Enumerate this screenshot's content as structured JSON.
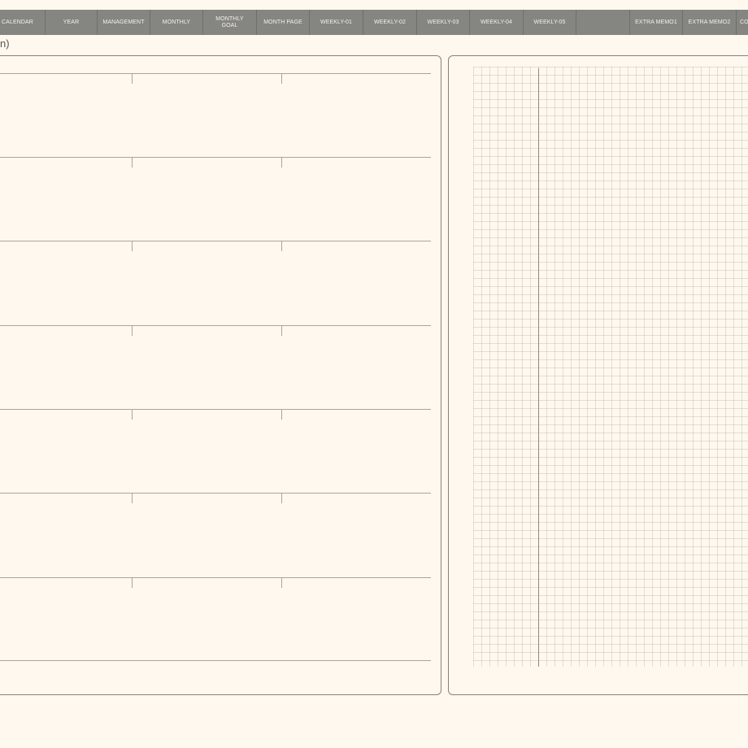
{
  "tabs": [
    {
      "name": "tab-calendar",
      "label": "CALENDAR"
    },
    {
      "name": "tab-year",
      "label": "YEAR"
    },
    {
      "name": "tab-management",
      "label": "MANAGEMENT"
    },
    {
      "name": "tab-monthly",
      "label": "MONTHLY"
    },
    {
      "name": "tab-monthly-goal",
      "label": "MONTHLY\nGOAL"
    },
    {
      "name": "tab-month-page",
      "label": "MONTH PAGE"
    },
    {
      "name": "tab-weekly-01",
      "label": "WEEKLY-01"
    },
    {
      "name": "tab-weekly-02",
      "label": "WEEKLY-02"
    },
    {
      "name": "tab-weekly-03",
      "label": "WEEKLY-03"
    },
    {
      "name": "tab-weekly-04",
      "label": "WEEKLY-04"
    },
    {
      "name": "tab-weekly-05",
      "label": "WEEKLY-05"
    },
    {
      "name": "tab-blank",
      "label": ""
    },
    {
      "name": "tab-extra-memo1",
      "label": "EXTRA MEMO1"
    },
    {
      "name": "tab-extra-memo2",
      "label": "EXTRA MEMO2"
    },
    {
      "name": "tab-co",
      "label": "CO"
    }
  ],
  "page": {
    "title": "n)"
  },
  "colors": {
    "background": "#fef8ee",
    "tabbar": "#858581",
    "tab_text": "#f4f1ea",
    "panel_border": "#86827c",
    "rule_line": "#a9a59f"
  }
}
